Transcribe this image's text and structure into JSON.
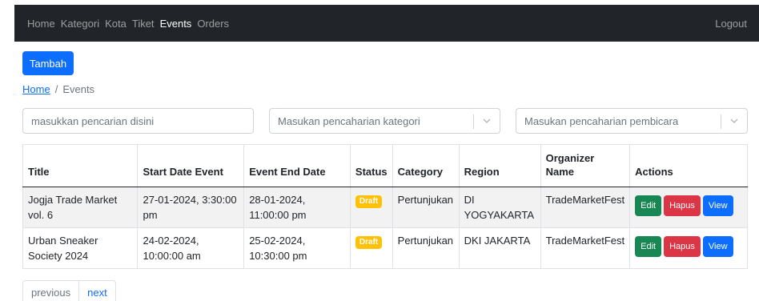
{
  "navbar": {
    "links": [
      "Home",
      "Kategori",
      "Kota",
      "Tiket",
      "Events",
      "Orders"
    ],
    "active": "Events",
    "logout": "Logout"
  },
  "add_button": "Tambah",
  "breadcrumb": {
    "home": "Home",
    "separator": "/",
    "current": "Events"
  },
  "filters": {
    "search_placeholder": "masukkan pencarian disini",
    "category_placeholder": "Masukan pencaharian kategori",
    "speaker_placeholder": "Masukan pencaharian pembicara"
  },
  "table": {
    "headers": [
      "Title",
      "Start Date Event",
      "Event End Date",
      "Status",
      "Category",
      "Region",
      "Organizer Name",
      "Actions"
    ],
    "rows": [
      {
        "title": "Jogja Trade Market vol. 6",
        "start": "27-01-2024, 3:30:00 pm",
        "end": "28-01-2024, 11:00:00 pm",
        "status": "Draft",
        "category": "Pertunjukan",
        "region": "DI YOGYAKARTA",
        "organizer": "TradeMarketFest"
      },
      {
        "title": "Urban Sneaker Society 2024",
        "start": "24-02-2024, 10:00:00 am",
        "end": "25-02-2024, 10:30:00 pm",
        "status": "Draft",
        "category": "Pertunjukan",
        "region": "DKI JAKARTA",
        "organizer": "TradeMarketFest"
      }
    ],
    "actions": {
      "edit": "Edit",
      "delete": "Hapus",
      "view": "View"
    }
  },
  "pagination": {
    "previous": "previous",
    "next": "next"
  },
  "colors": {
    "primary": "#0d6efd",
    "success": "#198754",
    "danger": "#dc3545",
    "warning": "#ffc107",
    "navbar": "#212529"
  }
}
